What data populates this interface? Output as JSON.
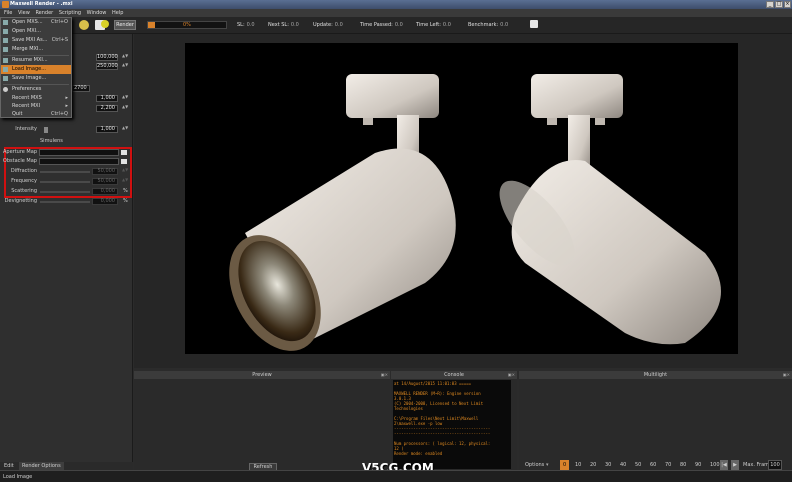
{
  "window": {
    "title": "Maxwell Render - .mxi"
  },
  "menubar": [
    "File",
    "View",
    "Render",
    "Scripting",
    "Window",
    "Help"
  ],
  "file_menu": [
    {
      "label": "Open MXS...",
      "shortcut": "Ctrl+O"
    },
    {
      "label": "Open MXI...",
      "shortcut": ""
    },
    {
      "label": "Save MXI As...",
      "shortcut": "Ctrl+S"
    },
    {
      "label": "Merge MXI...",
      "shortcut": ""
    },
    {
      "label": "Resume MXI...",
      "shortcut": ""
    },
    {
      "label": "Load Image...",
      "shortcut": "",
      "highlighted": true
    },
    {
      "label": "Save Image...",
      "shortcut": ""
    },
    {
      "label": "Preferences",
      "shortcut": ""
    },
    {
      "label": "Recent MXS",
      "shortcut": ""
    },
    {
      "label": "Recent MXI",
      "shortcut": ""
    },
    {
      "label": "Quit",
      "shortcut": "Ctrl+Q"
    }
  ],
  "toolbar": {
    "render_label": "Render",
    "progress_text": "0%",
    "progress": 0.09,
    "stats": [
      {
        "label": "SL:",
        "value": "0.0"
      },
      {
        "label": "Next SL:",
        "value": "0.0"
      },
      {
        "label": "Update:",
        "value": "0.0"
      },
      {
        "label": "Time Passed:",
        "value": "0.0"
      },
      {
        "label": "Time Left:",
        "value": "0.0"
      },
      {
        "label": "Benchmark:",
        "value": "0.0"
      }
    ]
  },
  "left_panel": {
    "values": [
      "100,000",
      "250,000",
      "1,000",
      "2,200"
    ],
    "combo_text": "2700",
    "intensity": {
      "label": "Intensity",
      "value": "1,000"
    },
    "simulens_title": "Simulens",
    "aperture_map": "Aperture Map",
    "obstacle_map": "Obstacle Map",
    "diffraction": {
      "label": "Diffraction",
      "value": "50,000"
    },
    "frequency": {
      "label": "Frequency",
      "value": "50,000"
    },
    "scattering": {
      "label": "Scattering",
      "value": "0,000",
      "unit": "%"
    },
    "devignetting": {
      "label": "Devignetting",
      "value": "0,000",
      "unit": "%"
    }
  },
  "bottom_tabs": {
    "edit": "Edit",
    "render_options": "Render Options"
  },
  "preview": {
    "title": "Preview",
    "refresh_label": "Refresh"
  },
  "console": {
    "title": "Console",
    "lines": [
      "at 14/August/2015 11:01:03 =====",
      "",
      "MAXWELL RENDER (M~R): Engine version",
      "3.0.1.3",
      "(C) 2004-2008, Licensed to Next Limit",
      "Technologies",
      "",
      "C:\\Program Files\\Next Limit\\Maxwell",
      "2\\maxwell.exe -p low",
      "----------------------------------------",
      "----------------------------------------",
      "",
      "Num processors: ( logical: 12, physical:",
      "12 )",
      "Render mode: enabled"
    ]
  },
  "multilight": {
    "title": "Multilight",
    "options_label": "Options",
    "scale": [
      "0",
      "10",
      "20",
      "30",
      "40",
      "50",
      "60",
      "70",
      "80",
      "90",
      "100"
    ],
    "max_frames_label": "Max. Frames:",
    "max_frames_value": "100"
  },
  "status_text": "Load Image",
  "watermark": "V5CG.COM",
  "colors": {
    "accent": "#d9822b",
    "highlight_box": "#d01010",
    "console_text": "#e08a20"
  }
}
